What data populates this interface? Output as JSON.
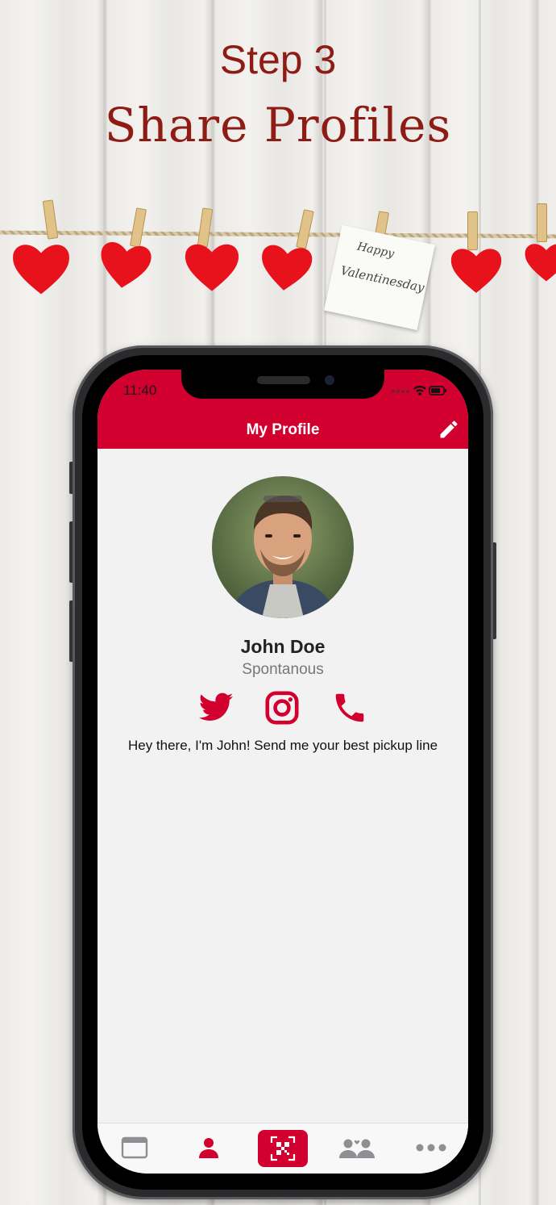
{
  "banner": {
    "step": "Step 3",
    "headline": "Share Profiles"
  },
  "note": {
    "line1": "Happy",
    "line2": "Valentinesday"
  },
  "status_bar": {
    "time": "11:40"
  },
  "header": {
    "title": "My Profile"
  },
  "profile": {
    "name": "John Doe",
    "tagline": "Spontanous",
    "bio": "Hey there, I'm John! Send me your best pickup line"
  },
  "icons": {
    "edit": "pencil-icon",
    "twitter": "twitter-icon",
    "instagram": "instagram-icon",
    "phone": "phone-icon"
  },
  "tabs": [
    "browse-tab",
    "profile-tab",
    "scan-tab",
    "matches-tab",
    "more-tab"
  ],
  "colors": {
    "accent": "#d1002f",
    "headline": "#8e1c14",
    "tab_inactive": "#8e8e93"
  }
}
